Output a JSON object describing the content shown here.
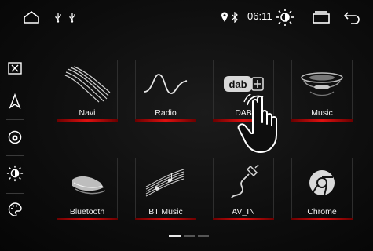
{
  "status": {
    "time": "06:11"
  },
  "apps": [
    {
      "label": "Navi",
      "icon": "navi-icon"
    },
    {
      "label": "Radio",
      "icon": "radio-wave-icon"
    },
    {
      "label": "DAB",
      "icon": "dab-plus-icon"
    },
    {
      "label": "Music",
      "icon": "music-disc-icon"
    },
    {
      "label": "Bluetooth",
      "icon": "bluetooth-phone-icon"
    },
    {
      "label": "BT Music",
      "icon": "bt-music-icon"
    },
    {
      "label": "AV_IN",
      "icon": "av-cable-icon"
    },
    {
      "label": "Chrome",
      "icon": "chrome-icon"
    }
  ],
  "pager": {
    "pages": 3,
    "active": 1
  },
  "colors": {
    "accent": "#e01010",
    "background": "#0e0e0e"
  }
}
